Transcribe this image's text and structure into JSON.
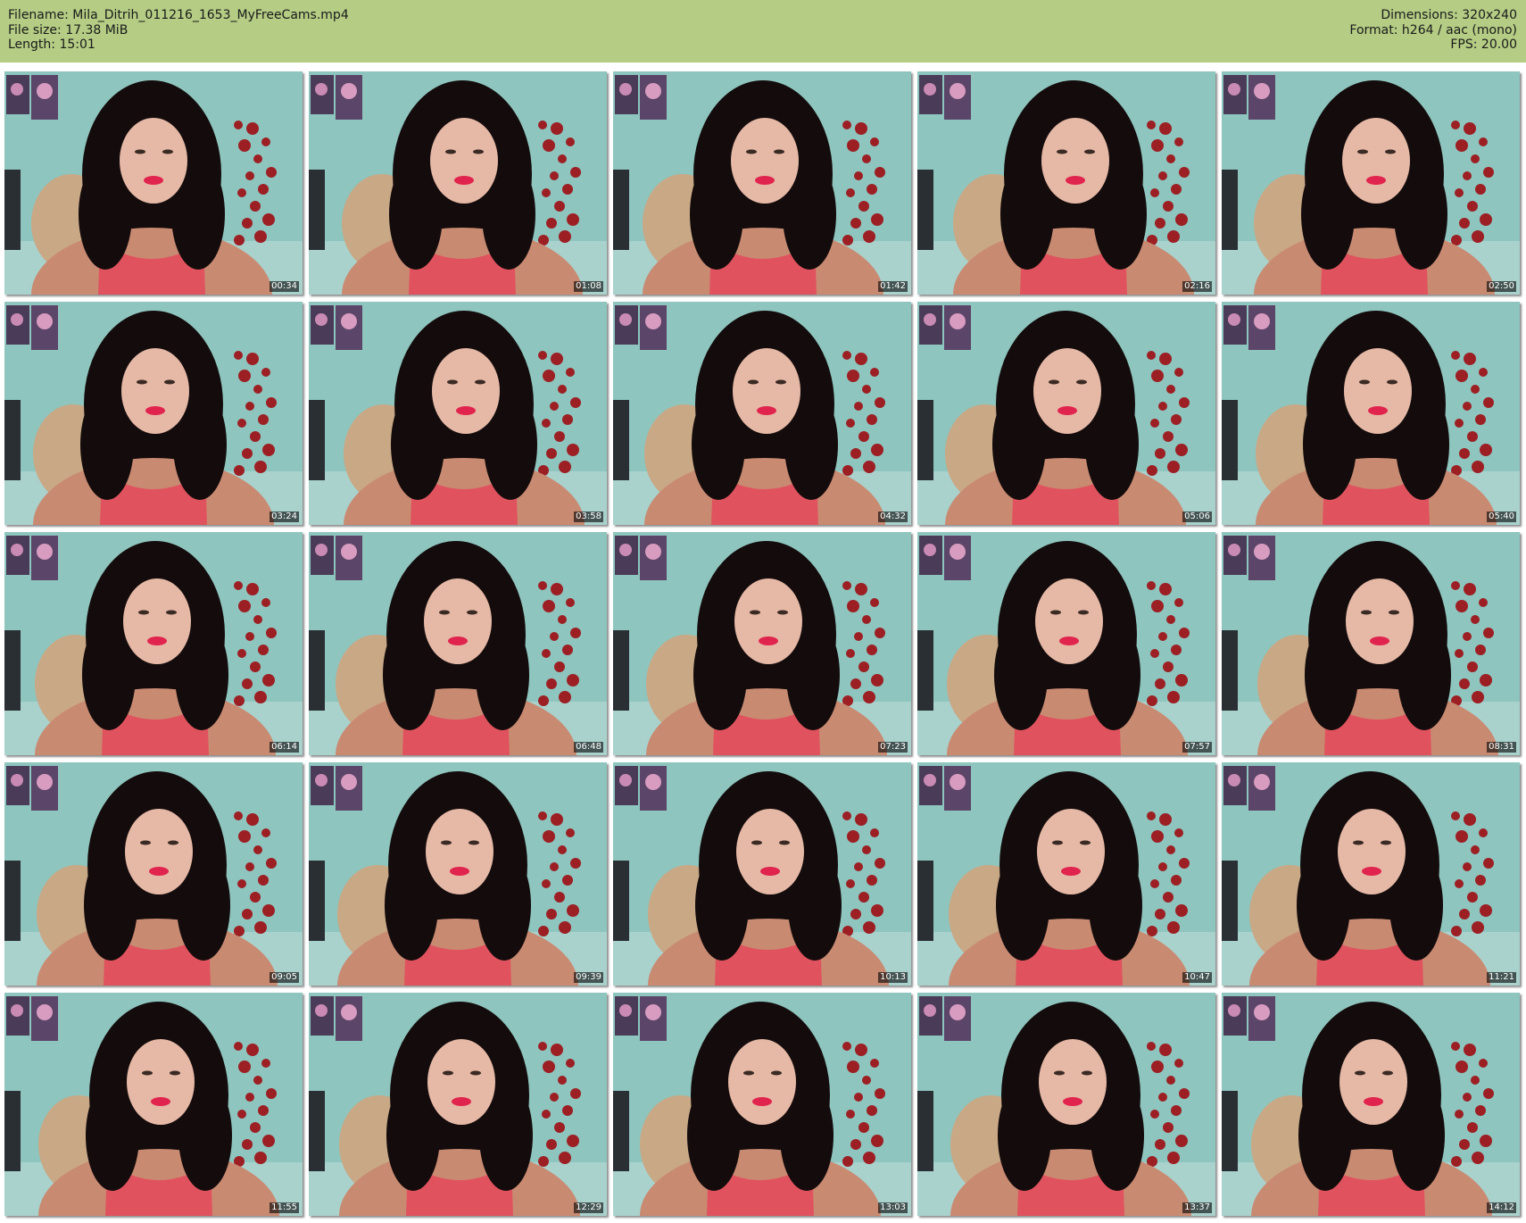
{
  "header": {
    "left": [
      "Filename: Mila_Ditrih_011216_1653_MyFreeCams.mp4",
      "File size: 17.38 MiB",
      "Length: 15:01"
    ],
    "right": [
      "Dimensions: 320x240",
      "Format: h264 / aac (mono)",
      "FPS: 20.00"
    ],
    "background_color": "#b4cc84"
  },
  "thumbnails": [
    {
      "timestamp": "00:34"
    },
    {
      "timestamp": "01:08"
    },
    {
      "timestamp": "01:42"
    },
    {
      "timestamp": "02:16"
    },
    {
      "timestamp": "02:50"
    },
    {
      "timestamp": "03:24"
    },
    {
      "timestamp": "03:58"
    },
    {
      "timestamp": "04:32"
    },
    {
      "timestamp": "05:06"
    },
    {
      "timestamp": "05:40"
    },
    {
      "timestamp": "06:14"
    },
    {
      "timestamp": "06:48"
    },
    {
      "timestamp": "07:23"
    },
    {
      "timestamp": "07:57"
    },
    {
      "timestamp": "08:31"
    },
    {
      "timestamp": "09:05"
    },
    {
      "timestamp": "09:39"
    },
    {
      "timestamp": "10:13"
    },
    {
      "timestamp": "10:47"
    },
    {
      "timestamp": "11:21"
    },
    {
      "timestamp": "11:55"
    },
    {
      "timestamp": "12:29"
    },
    {
      "timestamp": "13:03"
    },
    {
      "timestamp": "13:37"
    },
    {
      "timestamp": "14:12"
    }
  ]
}
